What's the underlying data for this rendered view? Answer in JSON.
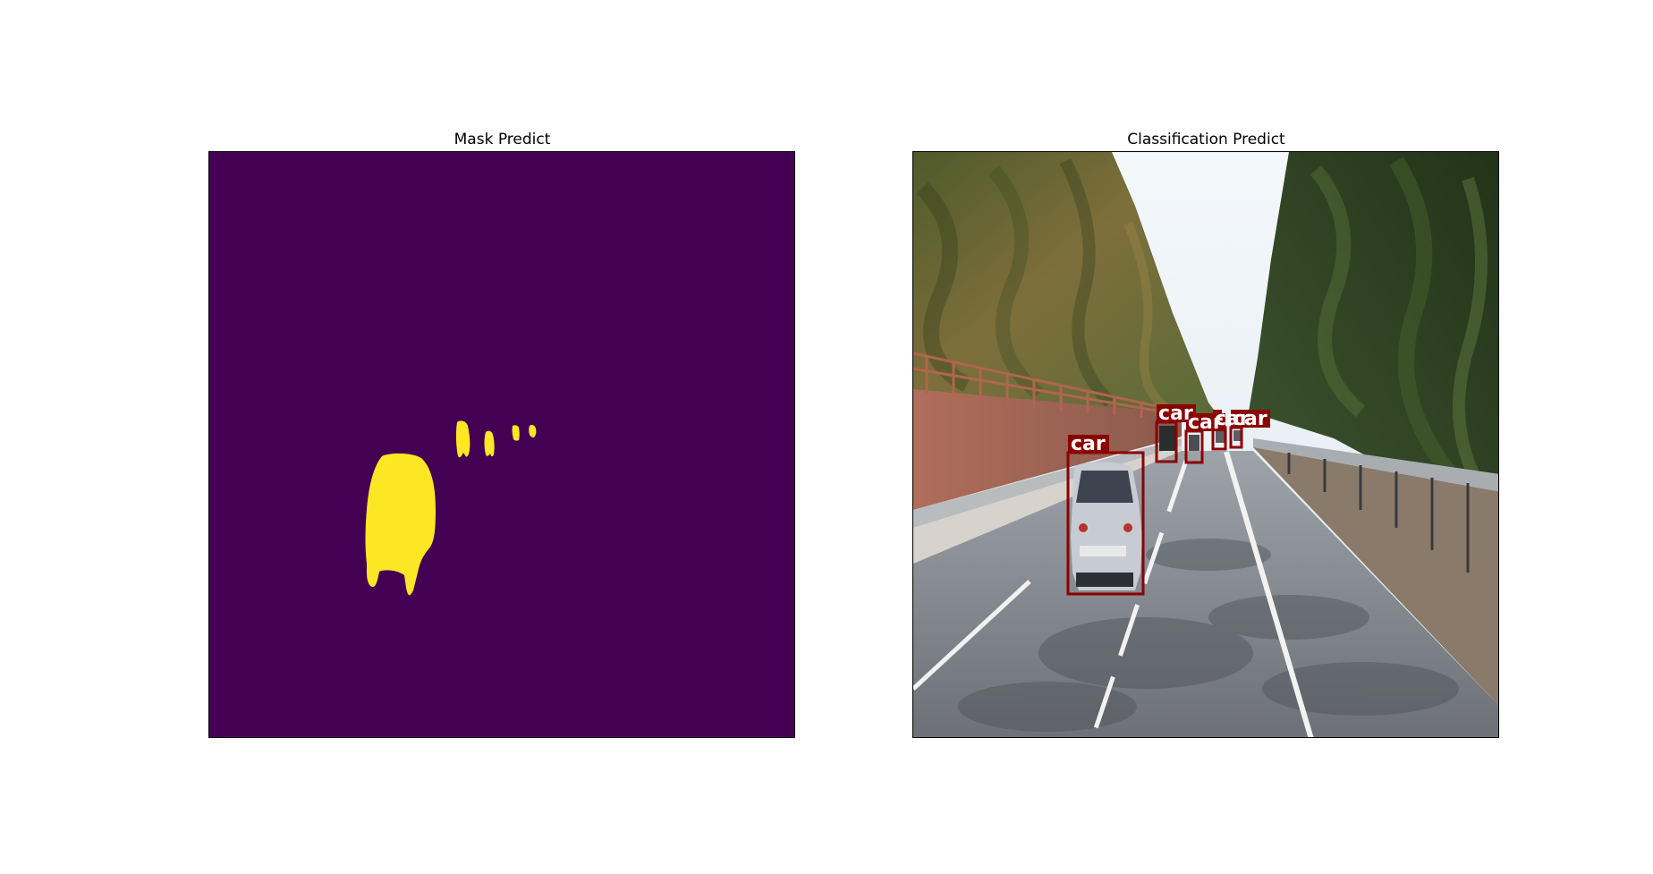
{
  "figure": {
    "left_panel": {
      "title": "Mask Predict",
      "background_color": "#440154",
      "mask_color": "#fde725"
    },
    "right_panel": {
      "title": "Classification Predict",
      "box_color": "#8b0000",
      "detections": [
        {
          "label": "car"
        },
        {
          "label": "car"
        },
        {
          "label": "car"
        },
        {
          "label": "car"
        },
        {
          "label": "car"
        }
      ]
    }
  }
}
